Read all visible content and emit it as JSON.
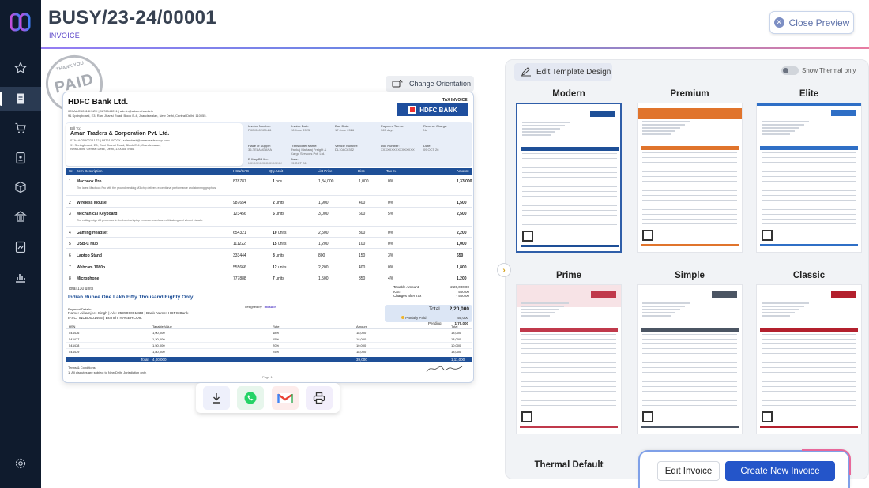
{
  "header": {
    "title": "BUSY/23-24/00001",
    "subtitle": "INVOICE",
    "close_label": "Close Preview"
  },
  "sidebar": {
    "items": [
      {
        "icon": "star-icon"
      },
      {
        "icon": "invoice-icon",
        "active": true
      },
      {
        "icon": "cart-icon"
      },
      {
        "icon": "ledger-icon"
      },
      {
        "icon": "box-icon"
      },
      {
        "icon": "bank-icon"
      },
      {
        "icon": "report-icon"
      },
      {
        "icon": "chart-icon"
      },
      {
        "icon": "settings-icon"
      }
    ]
  },
  "preview": {
    "orientation_label": "Change Orientation",
    "stamp_text": "PAID",
    "stamp_top": "THANK YOU",
    "company": {
      "name": "HDFC Bank Ltd.",
      "line1": "07AAACU2414K1ZH | 9876543211 | admin@aikamchawla.in",
      "line2": "91 Springboard, E3, Rani Jhansi Road, Block E-4, Jhandewalan, New Delhi, Central Delhi, 110055.",
      "tax_label": "TAX INVOICE",
      "bank_logo": "HDFC BANK"
    },
    "bill_to": {
      "label": "Bill To:",
      "name": "Aman Traders & Corporation Pvt. Ltd.",
      "line1": "07AAACB5022A1Z2 | 98761 0002X | salesdesk@amantradersorp.com",
      "line2": "91 Springboard, E3, Rani Jhansi Road, Block E-4, Jhandewalan,",
      "line3": "New Delhi, Central Delhi, Delhi, 110055, India"
    },
    "meta": [
      {
        "k": "Invoice Number:",
        "v": "PKB/0002/25-26"
      },
      {
        "k": "Invoice Date:",
        "v": "18 June 2025"
      },
      {
        "k": "Due Date:",
        "v": "17 June 2026"
      },
      {
        "k": "Payment Terms:",
        "v": "365 days"
      },
      {
        "k": "Reverse Charge:",
        "v": "No"
      },
      {
        "k": "Place of Supply:",
        "v": "36-TELANGANA"
      },
      {
        "k": "Transporter Name:",
        "v": "Pankaj Maharaj Freight & Cargo Services Pvt. Ltd."
      },
      {
        "k": "Vehicle Number:",
        "v": "DL10AC6352"
      },
      {
        "k": "Doc Number:",
        "v": "XXXXXXXXXXXXXXXX"
      },
      {
        "k": "Date:",
        "v": "09 OCT 26"
      },
      {
        "k": "E-Way Bill No:",
        "v": "XXXXXXXXXXXXXXXX"
      },
      {
        "k": "Date:",
        "v": "15 OCT 26"
      }
    ],
    "columns": [
      "Sr.",
      "Item Description",
      "HSN/SAC",
      "Qty. Unit",
      "List Price",
      "Disc",
      "Tax %",
      "Amount"
    ],
    "rows": [
      {
        "sr": "1",
        "item": "Macbook Pro",
        "desc": "The latest Macbook Pro with the groundbreaking M3 chip delivers exceptional performance and stunning graphics.",
        "hsn": "878787",
        "qty": "1",
        "unit": "pcs",
        "price": "1,34,000",
        "disc": "1,000",
        "tax": "0%",
        "amount": "1,33,000"
      },
      {
        "sr": "2",
        "item": "Wireless Mouse",
        "desc": "",
        "hsn": "987654",
        "qty": "2",
        "unit": "units",
        "price": "1,900",
        "disc": "400",
        "tax": "0%",
        "amount": "1,500"
      },
      {
        "sr": "3",
        "item": "Mechanical Keyboard",
        "desc": "The cutting-edge A9 processor in the Lumina laptop ensures seamless multitasking and vibrant visuals.",
        "hsn": "123456",
        "qty": "5",
        "unit": "units",
        "price": "3,000",
        "disc": "600",
        "tax": "5%",
        "amount": "2,500"
      },
      {
        "sr": "4",
        "item": "Gaming Headset",
        "desc": "",
        "hsn": "654321",
        "qty": "10",
        "unit": "units",
        "price": "2,500",
        "disc": "300",
        "tax": "0%",
        "amount": "2,200"
      },
      {
        "sr": "5",
        "item": "USB-C Hub",
        "desc": "",
        "hsn": "111222",
        "qty": "15",
        "unit": "units",
        "price": "1,200",
        "disc": "100",
        "tax": "0%",
        "amount": "1,000"
      },
      {
        "sr": "6",
        "item": "Laptop Stand",
        "desc": "",
        "hsn": "333444",
        "qty": "8",
        "unit": "units",
        "price": "800",
        "disc": "150",
        "tax": "3%",
        "amount": "650"
      },
      {
        "sr": "7",
        "item": "Webcam 1080p",
        "desc": "",
        "hsn": "555666",
        "qty": "12",
        "unit": "units",
        "price": "2,200",
        "disc": "400",
        "tax": "0%",
        "amount": "1,800"
      },
      {
        "sr": "8",
        "item": "Microphone",
        "desc": "",
        "hsn": "777888",
        "qty": "7",
        "unit": "units",
        "price": "1,500",
        "disc": "350",
        "tax": "4%",
        "amount": "1,200"
      }
    ],
    "total_units": "Total 130 units",
    "amount_words": "Indian Rupee One Lakh Fifty Thousand Eighty Only",
    "designed_by": "designed by",
    "designed_brand": "mosu.in",
    "summary": [
      {
        "k": "Taxable Amount",
        "v": "2,20,000.00"
      },
      {
        "k": "IGST",
        "v": "500.00"
      },
      {
        "k": "Charges after Tax",
        "v": "- 500.00"
      }
    ],
    "total_label": "Total",
    "total_value": "2,20,000",
    "partial_label": "Partially Paid",
    "partial_value": "50,000",
    "pending_label": "Pending",
    "pending_value": "1,70,000",
    "payment_label": "Payment Details:",
    "payment_line1": "Name: Aikamjeet Singh | A/c: 259500001833 | Bank Name: HDFC Bank |",
    "payment_line2": "IFSC: INDB0001465 | Branch: NAGERCOIL",
    "hsn_columns": [
      "HSN",
      "Taxable Value",
      "Rate",
      "Amount",
      "Total"
    ],
    "hsn_rows": [
      {
        "hsn": "543476",
        "val": "1,00,000",
        "rate": "18%",
        "amt": "18,000",
        "tot": "18,000"
      },
      {
        "hsn": "543477",
        "val": "1,20,000",
        "rate": "15%",
        "amt": "18,000",
        "tot": "18,000"
      },
      {
        "hsn": "543478",
        "val": "1,50,000",
        "rate": "20%",
        "amt": "10,000",
        "tot": "10,000"
      },
      {
        "hsn": "543479",
        "val": "1,80,000",
        "rate": "25%",
        "amt": "18,000",
        "tot": "18,000"
      }
    ],
    "grand": {
      "label": "Total",
      "val": "4,00,000",
      "amt": "39,000",
      "tot": "1,11,000"
    },
    "terms_label": "Terms & Conditions",
    "terms_1": "1. All disputes are subject to New Delhi Jurisdiction only.",
    "page": "Page 1"
  },
  "templates": {
    "edit_label": "Edit Template Design",
    "thermal_label": "Show Thermal only",
    "items": [
      {
        "name": "Modern",
        "selected": true,
        "accent": "#1e4f97"
      },
      {
        "name": "Premium",
        "selected": false,
        "accent": "#e0742c"
      },
      {
        "name": "Elite",
        "selected": false,
        "accent": "#2f6fc6"
      },
      {
        "name": "Prime",
        "selected": false,
        "accent": "#c0394b"
      },
      {
        "name": "Simple",
        "selected": false,
        "accent": "#4b5563"
      },
      {
        "name": "Classic",
        "selected": false,
        "accent": "#b3202d"
      }
    ],
    "thermal_default": "Thermal Default"
  },
  "actions": {
    "edit_invoice": "Edit Invoice",
    "create_new": "Create New Invoice"
  },
  "colors": {
    "rail": "#0f1b2d",
    "accent": "#2455c9",
    "table_header": "#1e4f97"
  }
}
